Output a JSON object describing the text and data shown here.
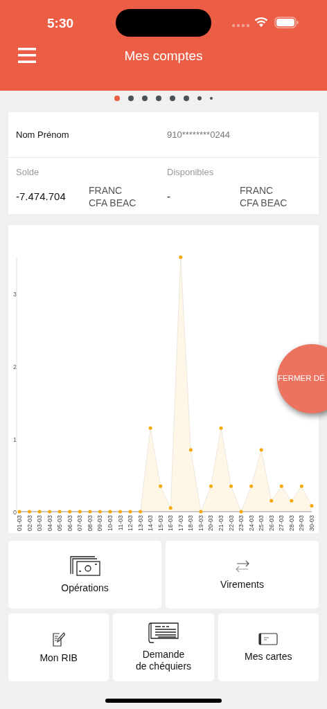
{
  "status_bar": {
    "time": "5:30"
  },
  "header": {
    "title": "Mes comptes"
  },
  "pager": [
    {
      "selected": true
    },
    {
      "selected": false
    },
    {
      "selected": false
    },
    {
      "selected": false
    },
    {
      "selected": false
    },
    {
      "selected": false
    },
    {
      "selected": false
    },
    {
      "selected": false
    }
  ],
  "account": {
    "holder": "Nom Prénom",
    "number": "910********0244",
    "balances": [
      {
        "label": "Solde",
        "amount": "-7.474.704",
        "currency": "FRANC\nCFA BEAC"
      },
      {
        "label": "Disponibles",
        "amount": "-",
        "currency": "FRANC\nCFA BEAC"
      }
    ]
  },
  "chart_data": {
    "type": "area",
    "categories": [
      "01-03",
      "02-03",
      "03-03",
      "04-03",
      "05-03",
      "06-03",
      "07-03",
      "08-03",
      "09-03",
      "10-03",
      "11-03",
      "12-03",
      "13-03",
      "14-03",
      "15-03",
      "16-03",
      "17-03",
      "18-03",
      "19-03",
      "20-03",
      "21-03",
      "22-03",
      "23-03",
      "24-03",
      "25-03",
      "26-03",
      "27-03",
      "28-03",
      "29-03",
      "30-03"
    ],
    "series": [
      {
        "color": "#f5a800",
        "values": [
          0,
          0,
          0,
          0,
          0,
          0,
          0,
          0,
          0,
          0,
          0,
          0,
          0,
          1.15,
          0.35,
          0.05,
          3.5,
          0.85,
          0,
          0.35,
          1.15,
          0.35,
          0,
          0.35,
          0.85,
          0.15,
          0.35,
          0.15,
          0.35,
          0.08
        ]
      }
    ],
    "ylim": [
      0,
      3.5
    ],
    "yticks": [
      0,
      1,
      2,
      3
    ]
  },
  "fab": {
    "label": "FERMER DÉ"
  },
  "tiles": [
    {
      "kind": "operations",
      "label": "Opérations"
    },
    {
      "kind": "transfers",
      "label": "Virements"
    },
    {
      "kind": "rib",
      "label": "Mon RIB"
    },
    {
      "kind": "checkbook",
      "label": "Demande\nde chéquiers"
    },
    {
      "kind": "cards",
      "label": "Mes cartes"
    }
  ]
}
